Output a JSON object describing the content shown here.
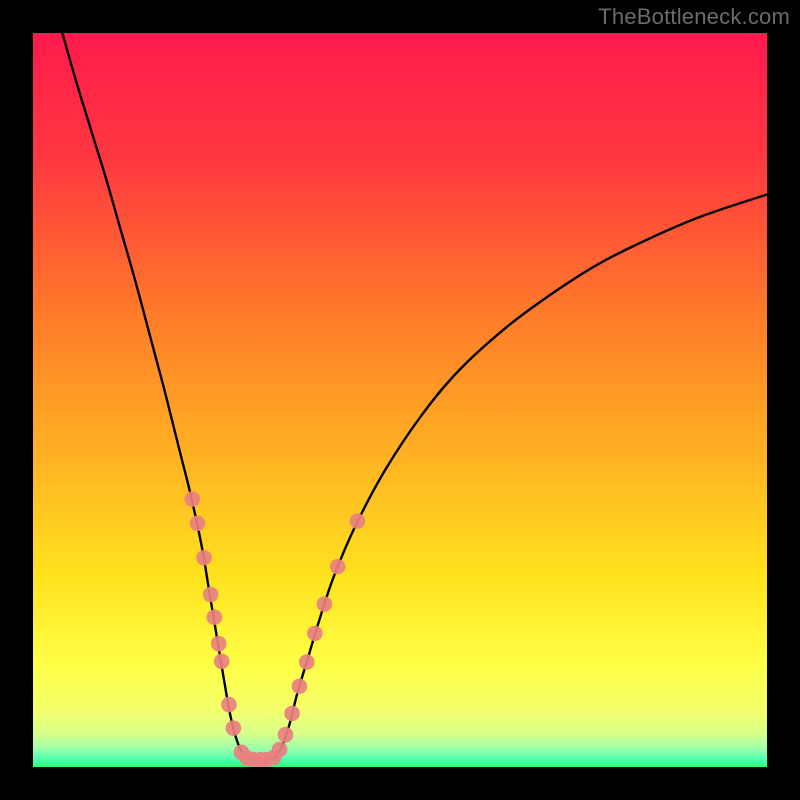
{
  "watermark": "TheBottleneck.com",
  "chart_data": {
    "type": "line",
    "title": "",
    "xlabel": "",
    "ylabel": "",
    "xlim": [
      0,
      100
    ],
    "ylim": [
      0,
      100
    ],
    "grid": false,
    "legend": false,
    "background_gradient": {
      "top": "#ff1a4d",
      "mid1": "#ff6a2a",
      "mid2": "#ffd21a",
      "mid3": "#ffff4d",
      "bottom_band": "#e6ff80",
      "bottom_edge": "#2aff73"
    },
    "series": [
      {
        "name": "bottleneck-curve",
        "color": "#000000",
        "points": [
          {
            "x": 4.0,
            "y": 100.0
          },
          {
            "x": 6.0,
            "y": 93.0
          },
          {
            "x": 8.0,
            "y": 86.5
          },
          {
            "x": 10.0,
            "y": 80.0
          },
          {
            "x": 12.0,
            "y": 73.0
          },
          {
            "x": 14.0,
            "y": 66.0
          },
          {
            "x": 16.0,
            "y": 58.5
          },
          {
            "x": 18.0,
            "y": 51.0
          },
          {
            "x": 20.0,
            "y": 43.0
          },
          {
            "x": 21.5,
            "y": 37.0
          },
          {
            "x": 23.0,
            "y": 30.0
          },
          {
            "x": 24.0,
            "y": 24.0
          },
          {
            "x": 25.0,
            "y": 18.0
          },
          {
            "x": 26.0,
            "y": 12.0
          },
          {
            "x": 27.0,
            "y": 6.5
          },
          {
            "x": 28.0,
            "y": 3.0
          },
          {
            "x": 29.0,
            "y": 1.3
          },
          {
            "x": 30.0,
            "y": 1.0
          },
          {
            "x": 31.0,
            "y": 1.0
          },
          {
            "x": 32.0,
            "y": 1.0
          },
          {
            "x": 33.0,
            "y": 1.3
          },
          {
            "x": 34.0,
            "y": 3.0
          },
          {
            "x": 35.0,
            "y": 6.0
          },
          {
            "x": 36.0,
            "y": 10.0
          },
          {
            "x": 37.5,
            "y": 15.0
          },
          {
            "x": 39.0,
            "y": 20.0
          },
          {
            "x": 41.0,
            "y": 26.0
          },
          {
            "x": 44.0,
            "y": 33.0
          },
          {
            "x": 48.0,
            "y": 40.5
          },
          {
            "x": 53.0,
            "y": 48.0
          },
          {
            "x": 58.0,
            "y": 54.0
          },
          {
            "x": 64.0,
            "y": 59.5
          },
          {
            "x": 70.0,
            "y": 64.0
          },
          {
            "x": 77.0,
            "y": 68.5
          },
          {
            "x": 84.0,
            "y": 72.0
          },
          {
            "x": 91.0,
            "y": 75.0
          },
          {
            "x": 100.0,
            "y": 78.0
          }
        ]
      }
    ],
    "markers": {
      "name": "highlight-dots",
      "color": "#e98080",
      "points": [
        {
          "x": 21.7,
          "y": 36.5
        },
        {
          "x": 22.4,
          "y": 33.2
        },
        {
          "x": 23.3,
          "y": 28.5
        },
        {
          "x": 24.2,
          "y": 23.5
        },
        {
          "x": 24.7,
          "y": 20.4
        },
        {
          "x": 25.3,
          "y": 16.8
        },
        {
          "x": 25.7,
          "y": 14.4
        },
        {
          "x": 26.7,
          "y": 8.5
        },
        {
          "x": 27.3,
          "y": 5.3
        },
        {
          "x": 28.4,
          "y": 2.0
        },
        {
          "x": 29.2,
          "y": 1.2
        },
        {
          "x": 30.0,
          "y": 1.0
        },
        {
          "x": 31.0,
          "y": 1.0
        },
        {
          "x": 31.8,
          "y": 1.0
        },
        {
          "x": 32.8,
          "y": 1.3
        },
        {
          "x": 33.6,
          "y": 2.4
        },
        {
          "x": 34.4,
          "y": 4.4
        },
        {
          "x": 35.3,
          "y": 7.3
        },
        {
          "x": 36.3,
          "y": 11.0
        },
        {
          "x": 37.3,
          "y": 14.3
        },
        {
          "x": 38.4,
          "y": 18.2
        },
        {
          "x": 39.7,
          "y": 22.2
        },
        {
          "x": 41.5,
          "y": 27.3
        },
        {
          "x": 44.2,
          "y": 33.5
        }
      ]
    }
  }
}
